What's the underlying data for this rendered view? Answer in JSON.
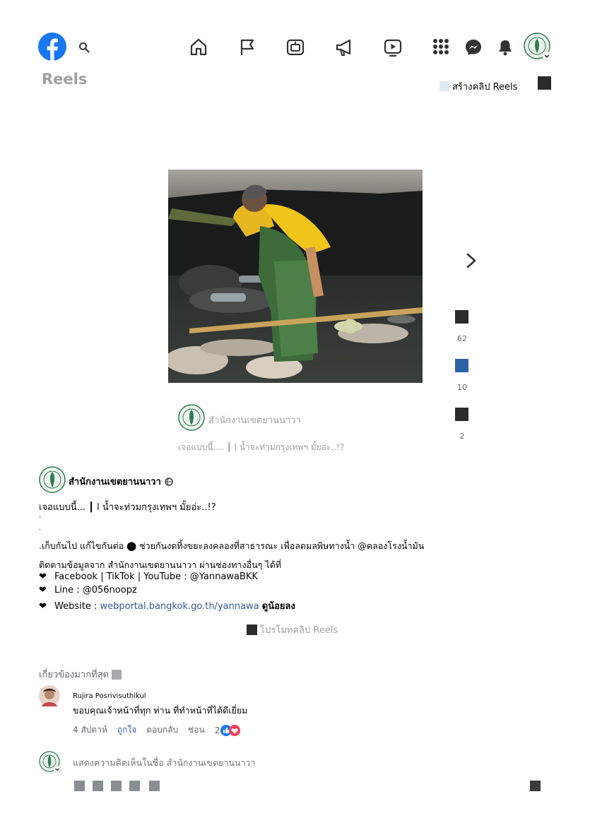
{
  "header": {
    "logo_icon": "facebook-logo-icon",
    "search_icon": "search-icon",
    "nav_icons": [
      "home-icon",
      "flag-icon",
      "watch-box-icon",
      "megaphone-icon",
      "video-play-icon"
    ],
    "right_icons": [
      "grid-menu-icon",
      "messenger-icon",
      "bell-icon",
      "profile-avatar-icon"
    ]
  },
  "page": {
    "title": "Reels",
    "create_label": "สร้างคลิป Reels"
  },
  "reel": {
    "account_name": "สำนักงานเขตยานนาวา",
    "caption_preview": "เจอแบบนี้.... ┃ l น้ำจะท่วมกรุงเทพฯ มั้ยอ่ะ..!?",
    "likes": "62",
    "comments": "10",
    "shares": "2"
  },
  "post": {
    "author": "สำนักงานเขตยานนาวา",
    "line1": "เจอแบบนี้... ┃ l น้ำจะท่วมกรุงเทพฯ มั้ยอ่ะ..!?",
    "dot1": ".",
    "dot2": ".",
    "line2": ".เก็บกันไป แก้ไขกันต่อ ⬤ ช่วยกันงดทิ้งขยะลงคลองที่สาธารณะ เพื่อลดมลพิษทางน้ำ @คลองโรงน้ำมัน",
    "line3": "ติดตามข้อมูลจาก สำนักงานเขตยานนาวา ผ่านช่องทางอื่นๆ ได้ที่",
    "facebook_line": "Facebook | TikTok | YouTube : @YannawaBKK",
    "line_line": "Line : @056noopz",
    "website_label": "Website :",
    "website_url": "webportal.bangkok.go.th/yannawa",
    "website_suffix": "ดูน้อยลง",
    "promote_label": "โปรโมทคลิป Reels"
  },
  "comments": {
    "sort_label": "เกี่ยวข้องมากที่สุด",
    "items": [
      {
        "name": "Rujira Posrivisuthikul",
        "text": "ขอบคุณเจ้าหน้าที่ทุก ท่าน ที่ทำหน้าที่ได้ดีเยี่ยม",
        "time": "4 สัปดาห์",
        "like": "ถูกใจ",
        "reply": "ตอบกลับ",
        "hide": "ซ่อน",
        "reaction_count": "2"
      }
    ],
    "input_placeholder": "แสดงความคิดเห็นในชื่อ สำนักงานเขตยานนาวา"
  },
  "colors": {
    "brand": "#1877f2",
    "link": "#385898",
    "reaction_like": "#1877f2",
    "reaction_love": "#f33e58"
  }
}
